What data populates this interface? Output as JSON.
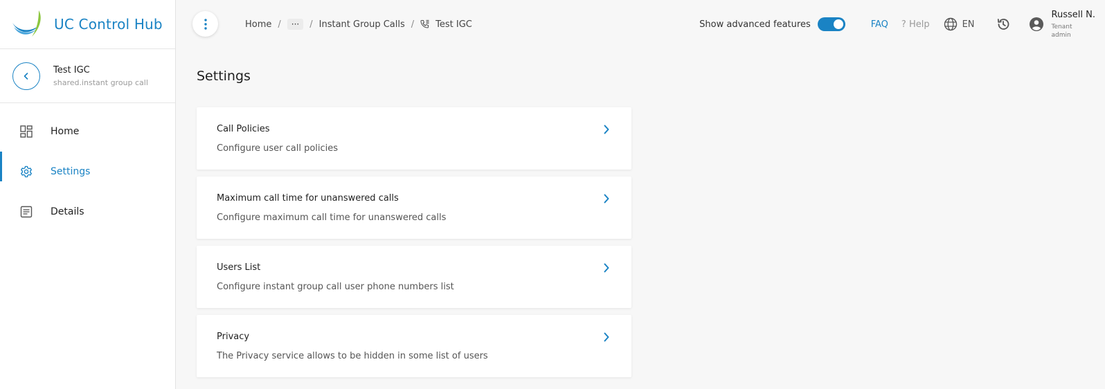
{
  "app": {
    "title": "UC Control Hub"
  },
  "entity": {
    "title": "Test IGC",
    "subtitle": "shared.instant group call"
  },
  "sidebar": {
    "items": [
      {
        "label": "Home",
        "icon": "dashboard-icon",
        "active": false
      },
      {
        "label": "Settings",
        "icon": "gear-icon",
        "active": true
      },
      {
        "label": "Details",
        "icon": "document-icon",
        "active": false
      }
    ]
  },
  "breadcrumb": {
    "items": [
      "Home",
      "Instant Group Calls",
      "Test IGC"
    ],
    "ellipsis": "···",
    "separator": "/"
  },
  "header": {
    "advanced_label": "Show advanced features",
    "advanced_enabled": true,
    "faq": "FAQ",
    "help": "? Help",
    "language": "EN",
    "user_name": "Russell N.",
    "user_role": "Tenant admin"
  },
  "page": {
    "title": "Settings"
  },
  "cards": [
    {
      "title": "Call Policies",
      "description": "Configure user call policies"
    },
    {
      "title": "Maximum call time for unanswered calls",
      "description": "Configure maximum call time for unanswered calls"
    },
    {
      "title": "Users List",
      "description": "Configure instant group call user phone numbers list"
    },
    {
      "title": "Privacy",
      "description": "The Privacy service allows to be hidden in some list of users"
    }
  ],
  "colors": {
    "accent": "#1a83c4",
    "logo_green": "#8cc63f",
    "background": "#f7f7f7"
  }
}
